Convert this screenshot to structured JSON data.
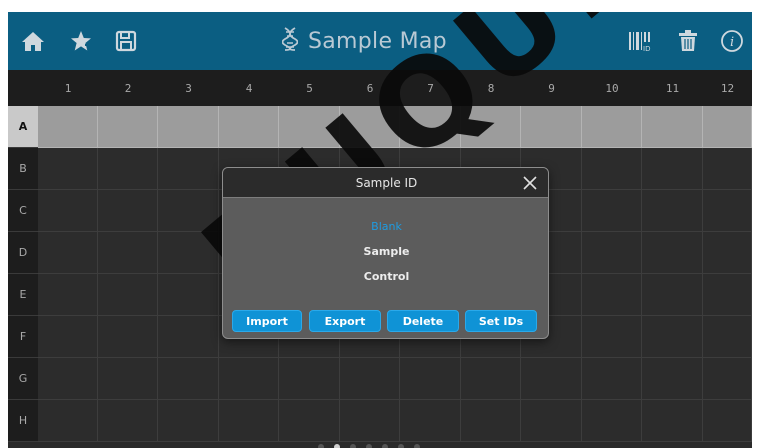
{
  "topbar": {
    "title": "Sample Map",
    "icons": [
      "home-icon",
      "favorite-star-icon",
      "save-icon",
      "dna-icon",
      "barcode-icon",
      "trash-icon",
      "info-icon"
    ]
  },
  "grid": {
    "columns": [
      "1",
      "2",
      "3",
      "4",
      "5",
      "6",
      "7",
      "8",
      "9",
      "10",
      "11",
      "12"
    ],
    "rows": [
      "A",
      "B",
      "C",
      "D",
      "E",
      "F",
      "G",
      "H"
    ],
    "selected_row": "A"
  },
  "dialog": {
    "title": "Sample ID",
    "options": [
      {
        "label": "Blank",
        "selected": true
      },
      {
        "label": "Sample",
        "selected": false
      },
      {
        "label": "Control",
        "selected": false
      }
    ],
    "buttons": {
      "import": "Import",
      "export": "Export",
      "delete": "Delete",
      "set_ids": "Set IDs"
    }
  },
  "pager": {
    "pages": 7,
    "current": 2
  },
  "watermark": "DUQUE",
  "colors": {
    "topbar": "#0b5e82",
    "accent": "#0f93d6",
    "selected_text": "#1e9be0",
    "background": "#2a2a2a"
  }
}
